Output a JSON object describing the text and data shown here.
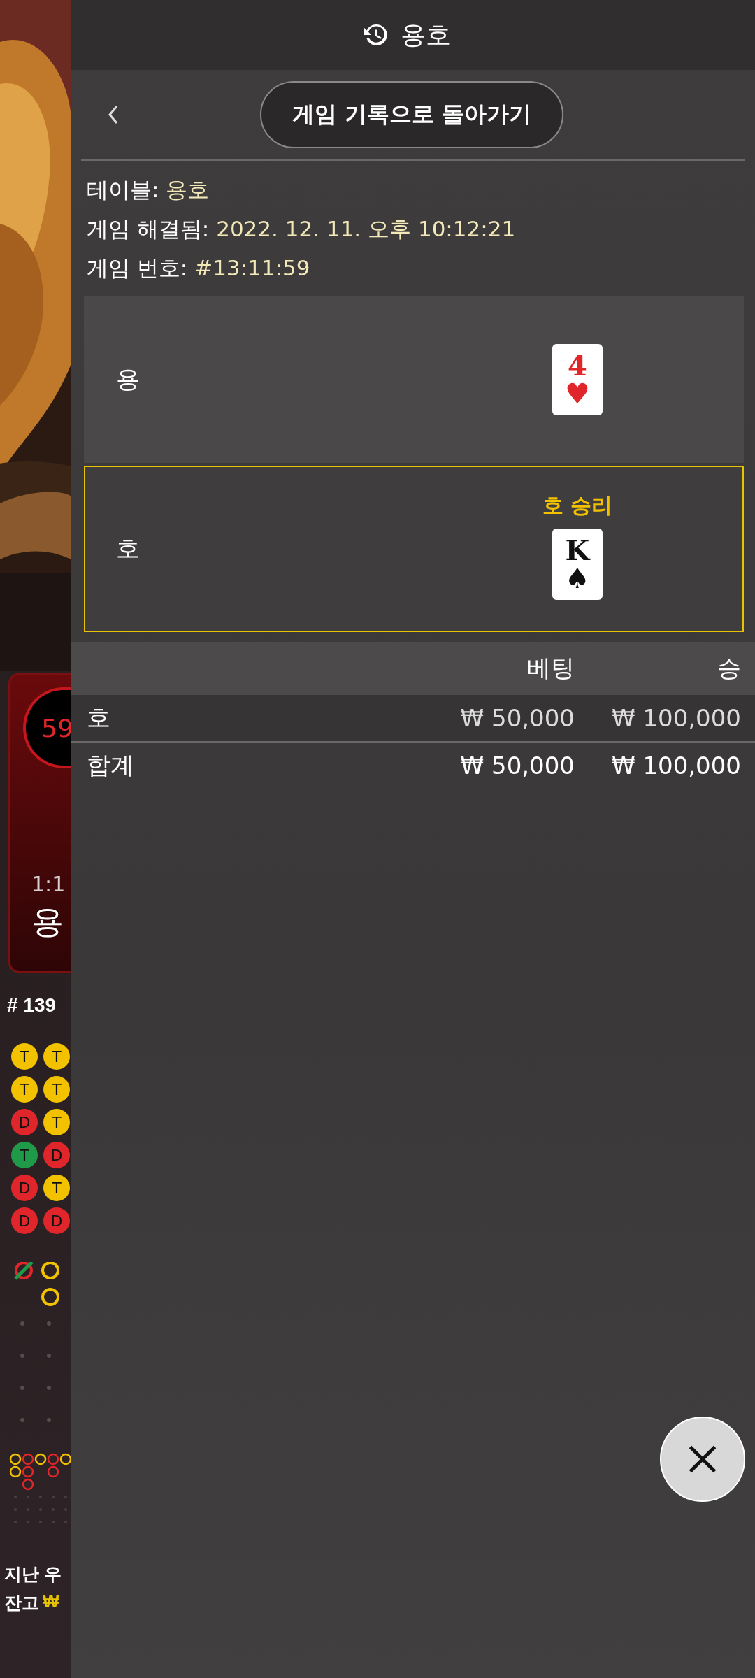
{
  "game_background": {
    "timer": "59",
    "odds": "1:1",
    "side_label": "용",
    "round_number": "# 139",
    "bead_road": [
      [
        {
          "label": "T",
          "color": "#f2c200"
        },
        {
          "label": "T",
          "color": "#f2c200"
        },
        {
          "label": "D",
          "color": "#e0262a"
        },
        {
          "label": "T",
          "color": "#1e9a48"
        },
        {
          "label": "D",
          "color": "#e0262a"
        },
        {
          "label": "D",
          "color": "#e0262a"
        }
      ],
      [
        {
          "label": "T",
          "color": "#f2c200"
        },
        {
          "label": "T",
          "color": "#f2c200"
        },
        {
          "label": "T",
          "color": "#f2c200"
        },
        {
          "label": "D",
          "color": "#e0262a"
        },
        {
          "label": "T",
          "color": "#f2c200"
        },
        {
          "label": "D",
          "color": "#e0262a"
        }
      ]
    ],
    "last_win_label": "지난 우",
    "balance_label": "잔고",
    "balance_currency": "₩"
  },
  "header": {
    "title": "용호"
  },
  "back_button": {
    "label": "게임 기록으로 돌아가기"
  },
  "details": [
    {
      "label": "테이블:",
      "value": "용호"
    },
    {
      "label": "게임 해결됨:",
      "value": "2022. 12. 11. 오후 10:12:21"
    },
    {
      "label": "게임 번호:",
      "value": "#13:11:59"
    }
  ],
  "hands": [
    {
      "name": "용",
      "winner": false,
      "card": {
        "rank": "4",
        "suit": "♥",
        "color": "#e0262a"
      }
    },
    {
      "name": "호",
      "winner": true,
      "result": "호 승리",
      "card": {
        "rank": "K",
        "suit": "♠",
        "color": "#111111"
      }
    }
  ],
  "bets": {
    "columns": [
      "베팅",
      "승"
    ],
    "rows": [
      {
        "kind": "row",
        "label": "호",
        "bet": "₩ 50,000",
        "win": "₩ 100,000"
      },
      {
        "kind": "total",
        "label": "합계",
        "bet": "₩ 50,000",
        "win": "₩ 100,000"
      }
    ]
  }
}
